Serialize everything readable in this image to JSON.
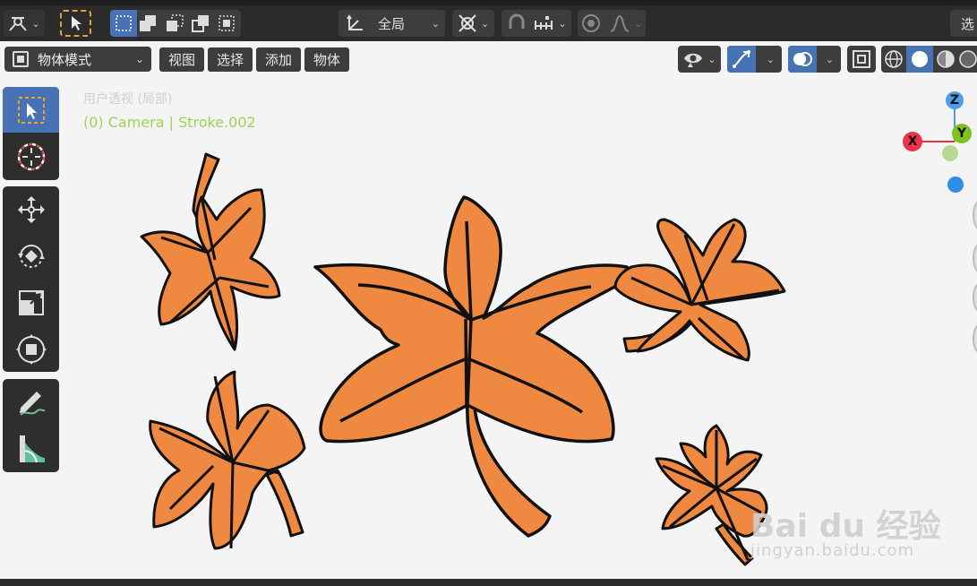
{
  "header": {
    "transform_orientation": "全局",
    "right_partial": "选"
  },
  "viewport_header": {
    "mode": "物体模式",
    "menus": [
      "视图",
      "选择",
      "添加",
      "物体"
    ]
  },
  "viewport": {
    "view_name": "用户透视 (局部)",
    "object_info": "(0) Camera | Stroke.002"
  },
  "gizmo": {
    "z": "Z",
    "y": "Y",
    "x": "X",
    "colors": {
      "x": "#e8334a",
      "y": "#7ec121",
      "z": "#4f9de8",
      "y_neg": "#b7d98b",
      "z_neg": "#2f8ee8"
    }
  },
  "watermark": {
    "brand": "Bai du 经验",
    "url": "jingyan.baidu.com"
  },
  "colors": {
    "leaf_fill": "#ef8840",
    "leaf_stroke": "#111111",
    "accent": "#4772b3"
  },
  "icons": [
    "editor-type-icon",
    "select-arrow-icon",
    "select-box-icon",
    "transform-orientation-icon",
    "pivot-icon",
    "snap-icon",
    "proportional-edit-icon",
    "visibility-icon",
    "gizmo-icon",
    "overlay-icon",
    "xray-icon",
    "wireframe-icon",
    "solid-icon",
    "material-icon",
    "cursor-icon",
    "move-icon",
    "rotate-icon",
    "scale-icon",
    "transform-icon",
    "annotate-icon",
    "measure-icon"
  ]
}
